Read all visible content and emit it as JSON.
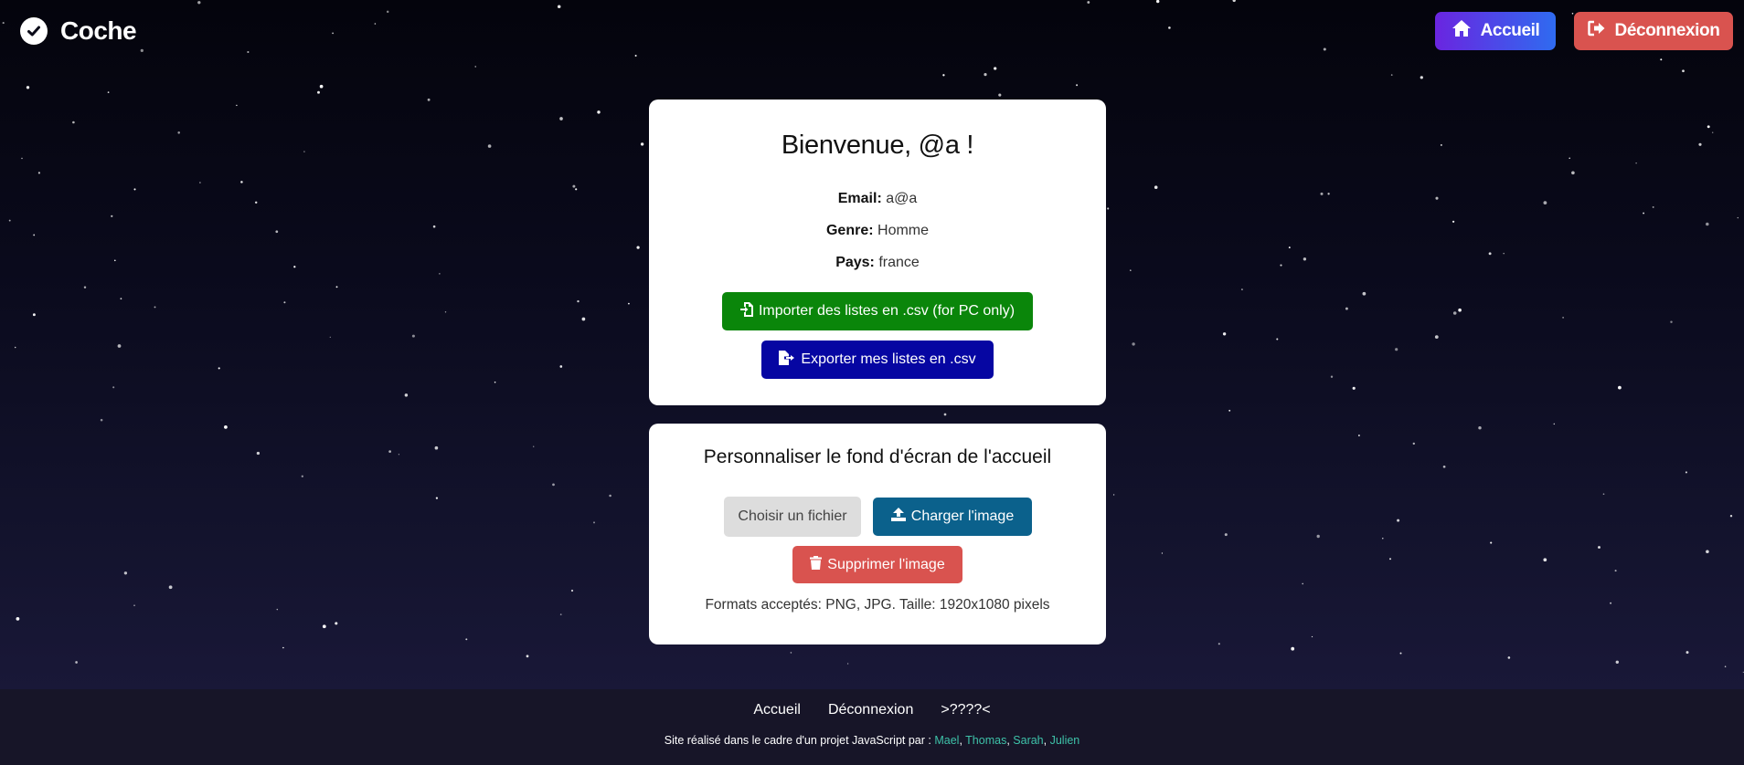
{
  "header": {
    "app_name": "Coche",
    "nav": {
      "home_label": "Accueil",
      "logout_label": "Déconnexion"
    }
  },
  "profile": {
    "welcome": "Bienvenue, @a !",
    "email_label": "Email:",
    "email_value": " a@a",
    "genre_label": "Genre:",
    "genre_value": " Homme",
    "pays_label": "Pays:",
    "pays_value": " france",
    "import_label": "Importer des listes en .csv (for PC only)",
    "export_label": "Exporter mes listes en .csv"
  },
  "wallpaper": {
    "title": "Personnaliser le fond d'écran de l'accueil",
    "choose_file_label": "Choisir un fichier",
    "upload_label": "Charger l'image",
    "delete_label": "Supprimer l'image",
    "formats_text": "Formats acceptés: PNG, JPG. Taille: 1920x1080 pixels"
  },
  "footer": {
    "links": [
      "Accueil",
      "Déconnexion",
      ">????<"
    ],
    "credits_prefix": "Site réalisé dans le cadre d'un projet JavaScript par : ",
    "authors": [
      "Mael",
      "Thomas",
      "Sarah",
      "Julien"
    ],
    "separator": ", "
  },
  "colors": {
    "home_gradient_start": "#6a25e0",
    "home_gradient_end": "#2f6bf0",
    "logout_red": "#d9534f",
    "import_green": "#0a860a",
    "export_blue": "#0606a2",
    "upload_blue": "#0b618c",
    "author_teal": "#3ec2a9"
  },
  "icons": {
    "brand": "check-circle-icon",
    "home": "home-icon",
    "logout": "sign-out-icon",
    "import": "file-import-icon",
    "export": "file-export-icon",
    "upload": "upload-icon",
    "delete": "trash-icon"
  }
}
